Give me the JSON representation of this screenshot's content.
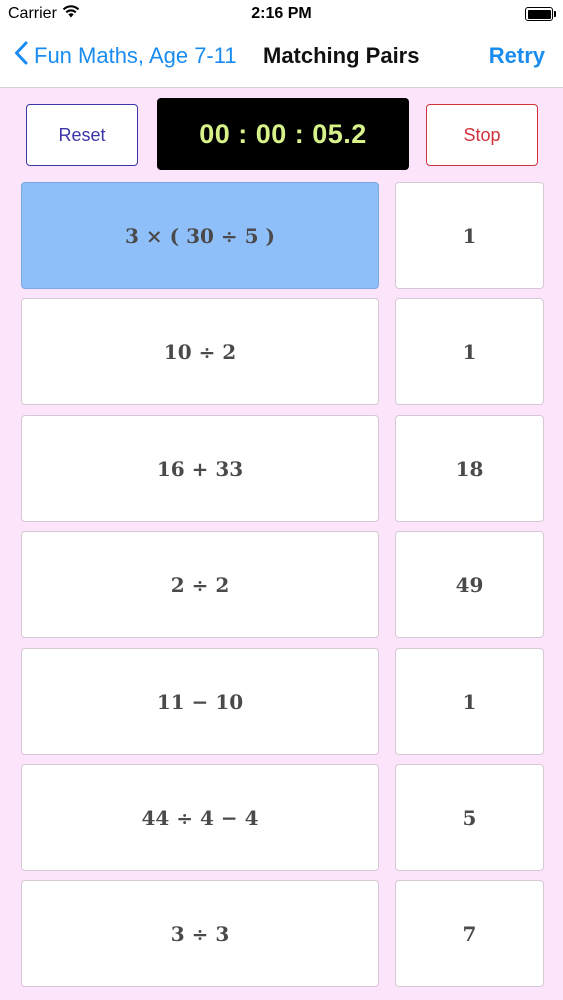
{
  "status_bar": {
    "carrier": "Carrier",
    "time": "2:16 PM"
  },
  "nav": {
    "back_label": "Fun Maths, Age 7-11",
    "title": "Matching Pairs",
    "retry_label": "Retry"
  },
  "controls": {
    "reset_label": "Reset",
    "timer": "00 : 00 : 05.2",
    "stop_label": "Stop"
  },
  "colors": {
    "accent": "#1a8cf0",
    "background": "#fce4fb",
    "selected_card": "#8fbff9",
    "reset": "#3b35a8",
    "stop": "#d1323c",
    "timer_text": "#d8f28a"
  },
  "expressions": [
    {
      "text": "3 × ( 30 ÷ 5 )",
      "selected": true
    },
    {
      "text": "10 ÷ 2",
      "selected": false
    },
    {
      "text": "16 + 33",
      "selected": false
    },
    {
      "text": "2 ÷ 2",
      "selected": false
    },
    {
      "text": "11 − 10",
      "selected": false
    },
    {
      "text": "44 ÷ 4 − 4",
      "selected": false
    },
    {
      "text": "3 ÷ 3",
      "selected": false
    }
  ],
  "answers": [
    {
      "text": "1"
    },
    {
      "text": "1"
    },
    {
      "text": "18"
    },
    {
      "text": "49"
    },
    {
      "text": "1"
    },
    {
      "text": "5"
    },
    {
      "text": "7"
    }
  ]
}
